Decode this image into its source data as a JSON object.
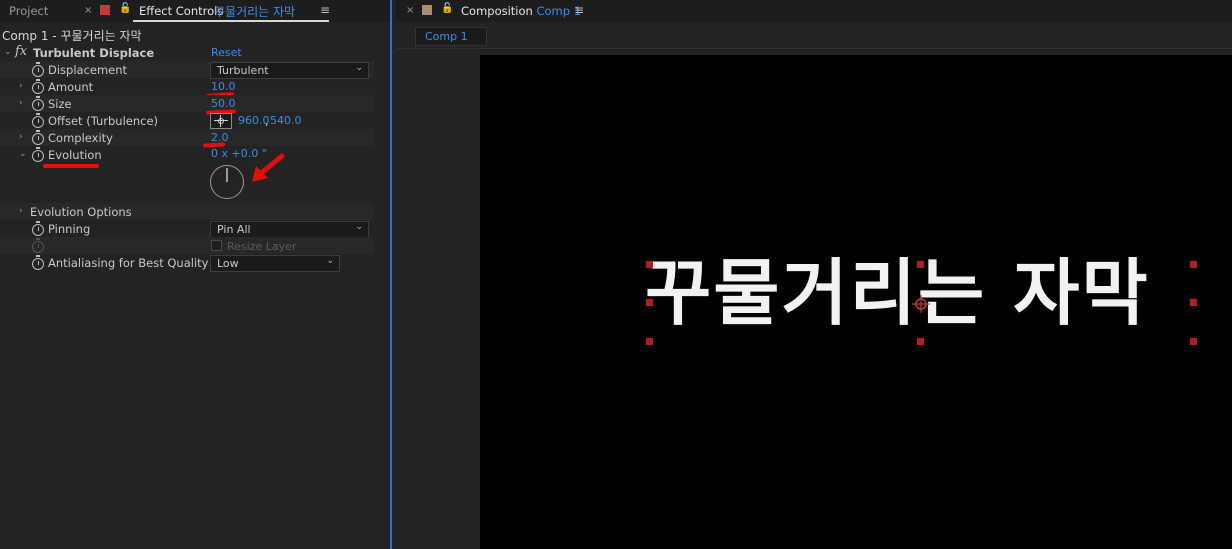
{
  "left_panel": {
    "tabs": {
      "project": "Project",
      "effect_controls": "Effect Controls",
      "layer_name": "꾸물거리는 자막"
    },
    "comp_header": {
      "comp": "Comp 1",
      "separator": " - ",
      "layer": "꾸물거리는 자막"
    },
    "effect": {
      "icon": "fx",
      "name": "Turbulent Displace",
      "reset_label": "Reset"
    },
    "properties": {
      "displacement": {
        "label": "Displacement",
        "value": "Turbulent"
      },
      "amount": {
        "label": "Amount",
        "value": "10.0"
      },
      "size": {
        "label": "Size",
        "value": "50.0"
      },
      "offset": {
        "label": "Offset (Turbulence)",
        "x": "960.0",
        "sep": ",",
        "y": "540.0"
      },
      "complexity": {
        "label": "Complexity",
        "value": "2.0"
      },
      "evolution": {
        "label": "Evolution",
        "value": "0 x +0.0 °"
      },
      "evolution_options": {
        "label": "Evolution Options"
      },
      "pinning": {
        "label": "Pinning",
        "value": "Pin All"
      },
      "resize_layer": {
        "label": "Resize Layer"
      },
      "antialiasing": {
        "label": "Antialiasing for Best Quality",
        "value": "Low"
      }
    }
  },
  "right_panel": {
    "tab": {
      "prefix": "Composition",
      "name": "Comp 1"
    },
    "subtab": "Comp 1",
    "viewer_text": "꾸물거리는 자막"
  },
  "colors": {
    "accent_blue": "#3b8dea",
    "annotation_red": "#e20f0f",
    "panel_bg": "#232323",
    "viewer_bg": "#000000"
  },
  "icons": [
    "close-icon",
    "red-label-swatch",
    "lock-icon",
    "panel-menu-icon",
    "fx-icon",
    "stopwatch-icon",
    "expand-arrow-icon",
    "dropdown-chevron-icon",
    "crosshair-icon",
    "anchor-point-icon",
    "annotation-arrow-icon"
  ]
}
